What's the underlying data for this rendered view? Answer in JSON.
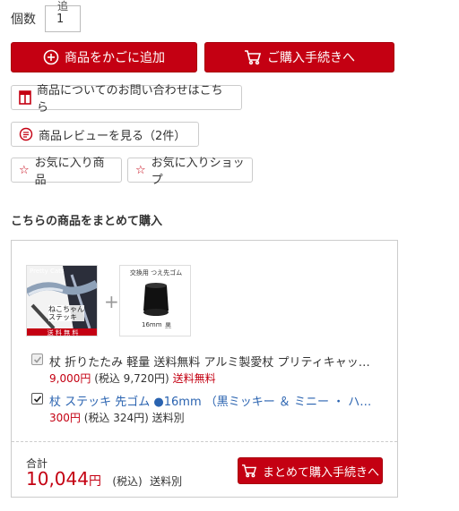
{
  "quantity": {
    "label": "個数",
    "value": "1",
    "cut_label": "追"
  },
  "buttons": {
    "add_to_cart": "商品をかごに追加",
    "checkout": "ご購入手続きへ",
    "inquiry": "商品についてのお問い合わせはこちら",
    "reviews": "商品レビューを見る（2件）",
    "fav_item": "お気に入り商品",
    "fav_shop": "お気に入りショップ"
  },
  "bundle": {
    "title": "こちらの商品をまとめて購入",
    "thumb1": {
      "brand": "Pretty Cats",
      "caption": "ねこちゃん\nステッキ",
      "ribbon": "送 料 無 料"
    },
    "thumb2": {
      "header": "交換用 つえ先ゴム",
      "size": "16mm",
      "color": "黒"
    },
    "items": [
      {
        "name": "杖 折りたたみ 軽量 送料無料 アルミ製愛杖 プリティキャッ…",
        "price": "9,000円",
        "tax": "(税込 9,720円)",
        "shipping": "送料無料",
        "checked": true,
        "disabled": true
      },
      {
        "name": "杖 ステッキ 先ゴム ●16mm （黒ミッキー ＆ ミニー ・ ハ…",
        "price": "300円",
        "tax": "(税込 324円)",
        "shipping": "送料別",
        "checked": true,
        "disabled": false
      }
    ],
    "total_label": "合計",
    "total_price": "10,044",
    "total_yen": "円",
    "total_tax": "(税込)",
    "total_shipping": "送料別",
    "checkout_label": "まとめて購入手続きへ"
  },
  "colors": {
    "accent": "#c40012",
    "link": "#2a63b0"
  }
}
